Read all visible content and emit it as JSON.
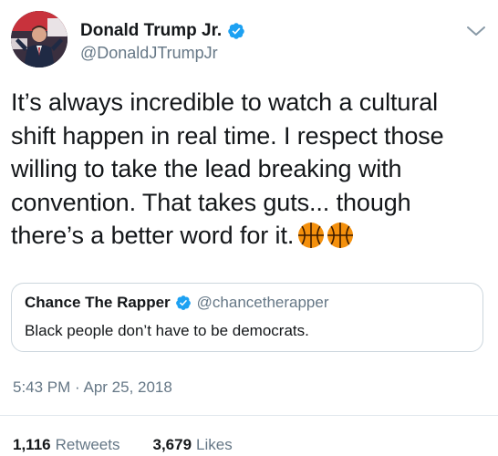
{
  "author": {
    "display_name": "Donald Trump Jr.",
    "handle": "@DonaldJTrumpJr",
    "verified": true
  },
  "tweet": {
    "text": "It’s always incredible to watch a cultural shift happen in real time. I respect those willing to take the lead breaking with convention. That takes guts... though there’s a better word for it.",
    "emojis": [
      "basketball",
      "basketball"
    ]
  },
  "quoted_tweet": {
    "display_name": "Chance The Rapper",
    "handle": "@chancetherapper",
    "verified": true,
    "text": "Black people don’t have to be democrats."
  },
  "timestamp": "5:43 PM · Apr 25, 2018",
  "stats": {
    "retweets_count": "1,116",
    "retweets_label": "Retweets",
    "likes_count": "3,679",
    "likes_label": "Likes"
  },
  "colors": {
    "verified_blue": "#1da1f2",
    "secondary_text": "#657786",
    "primary_text": "#14171a",
    "basketball_orange": "#f4900c"
  },
  "icons": {
    "verified": "verified-badge-icon",
    "menu": "chevron-down-icon",
    "emoji": "basketball-icon"
  }
}
